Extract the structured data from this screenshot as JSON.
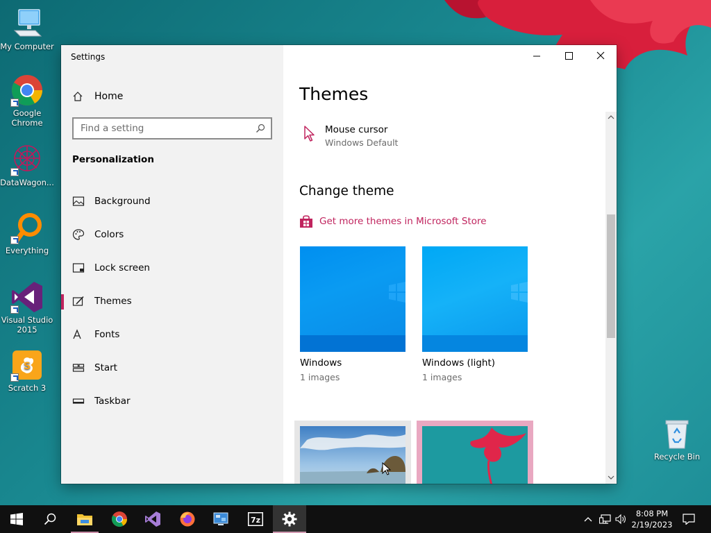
{
  "desktop": {
    "icons": [
      {
        "label": "My Computer",
        "icon": "computer-icon"
      },
      {
        "label": "Google Chrome",
        "icon": "chrome-icon"
      },
      {
        "label": "DataWagon...",
        "icon": "datawagon-icon"
      },
      {
        "label": "Everything",
        "icon": "everything-icon"
      },
      {
        "label": "Visual Studio 2015",
        "icon": "visual-studio-icon"
      },
      {
        "label": "Scratch 3",
        "icon": "scratch-icon"
      }
    ],
    "recycle_bin": {
      "label": "Recycle Bin",
      "icon": "recycle-bin-icon"
    }
  },
  "window": {
    "title": "Settings",
    "nav": {
      "home_label": "Home",
      "search_placeholder": "Find a setting",
      "section_heading": "Personalization",
      "items": [
        {
          "label": "Background",
          "icon": "picture-icon",
          "active": false
        },
        {
          "label": "Colors",
          "icon": "palette-icon",
          "active": false
        },
        {
          "label": "Lock screen",
          "icon": "lock-screen-icon",
          "active": false
        },
        {
          "label": "Themes",
          "icon": "brush-icon",
          "active": true
        },
        {
          "label": "Fonts",
          "icon": "font-icon",
          "active": false
        },
        {
          "label": "Start",
          "icon": "start-layout-icon",
          "active": false
        },
        {
          "label": "Taskbar",
          "icon": "taskbar-icon",
          "active": false
        }
      ]
    },
    "content": {
      "title": "Themes",
      "mouse_cursor": {
        "label": "Mouse cursor",
        "value": "Windows Default"
      },
      "change_theme_heading": "Change theme",
      "store_link": "Get more themes in Microsoft Store",
      "themes": [
        {
          "name": "Windows",
          "count": "1 images"
        },
        {
          "name": "Windows (light)",
          "count": "1 images"
        }
      ]
    }
  },
  "taskbar": {
    "time": "8:08 PM",
    "date": "2/19/2023",
    "apps": [
      "start-icon",
      "search-icon",
      "file-explorer-icon",
      "chrome-icon",
      "visual-studio-icon",
      "firefox-icon",
      "remote-desktop-icon",
      "7zip-icon",
      "settings-gear-icon"
    ]
  },
  "colors": {
    "accent": "#c0245e",
    "nav_background": "#f2f2f2",
    "taskbar": "#101010"
  }
}
